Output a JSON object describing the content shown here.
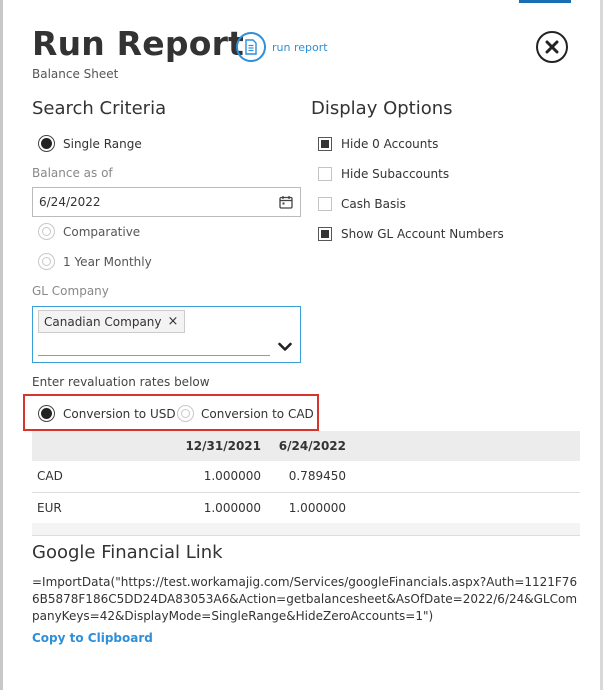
{
  "header": {
    "title": "Run Report",
    "subtitle": "Balance Sheet",
    "run_label": "run report"
  },
  "search_criteria": {
    "heading": "Search Criteria",
    "options": [
      {
        "label": "Single Range",
        "selected": true
      },
      {
        "label": "Comparative",
        "selected": false
      },
      {
        "label": "1 Year Monthly",
        "selected": false
      }
    ],
    "balance_as_of_label": "Balance as of",
    "balance_as_of_value": "6/24/2022",
    "gl_company_label": "GL Company",
    "gl_company_selected": [
      "Canadian Company"
    ],
    "token_remove": "×"
  },
  "display_options": {
    "heading": "Display Options",
    "items": [
      {
        "label": "Hide 0 Accounts",
        "checked": true
      },
      {
        "label": "Hide Subaccounts",
        "checked": false
      },
      {
        "label": "Cash Basis",
        "checked": false
      },
      {
        "label": "Show GL Account Numbers",
        "checked": true
      }
    ]
  },
  "revaluation": {
    "label": "Enter revaluation rates below",
    "options": [
      {
        "label": "Conversion to USD",
        "selected": true
      },
      {
        "label": "Conversion to CAD",
        "selected": false
      }
    ]
  },
  "rates_table": {
    "columns": [
      "",
      "12/31/2021",
      "6/24/2022"
    ],
    "rows": [
      [
        "CAD",
        "1.000000",
        "0.789450"
      ],
      [
        "EUR",
        "1.000000",
        "1.000000"
      ]
    ]
  },
  "google_link": {
    "heading": "Google Financial Link",
    "formula": "=ImportData(\"https://test.workamajig.com/Services/googleFinancials.aspx?Auth=1121F766B5878F186C5DD24DA83053A6&Action=getbalancesheet&AsOfDate=2022/6/24&GLCompanyKeys=42&DisplayMode=SingleRange&HideZeroAccounts=1\")",
    "copy_label": "Copy to Clipboard"
  },
  "colors": {
    "link": "#2f8fd8",
    "highlight_border": "#d9342b",
    "table_header_bg": "#ececec"
  }
}
